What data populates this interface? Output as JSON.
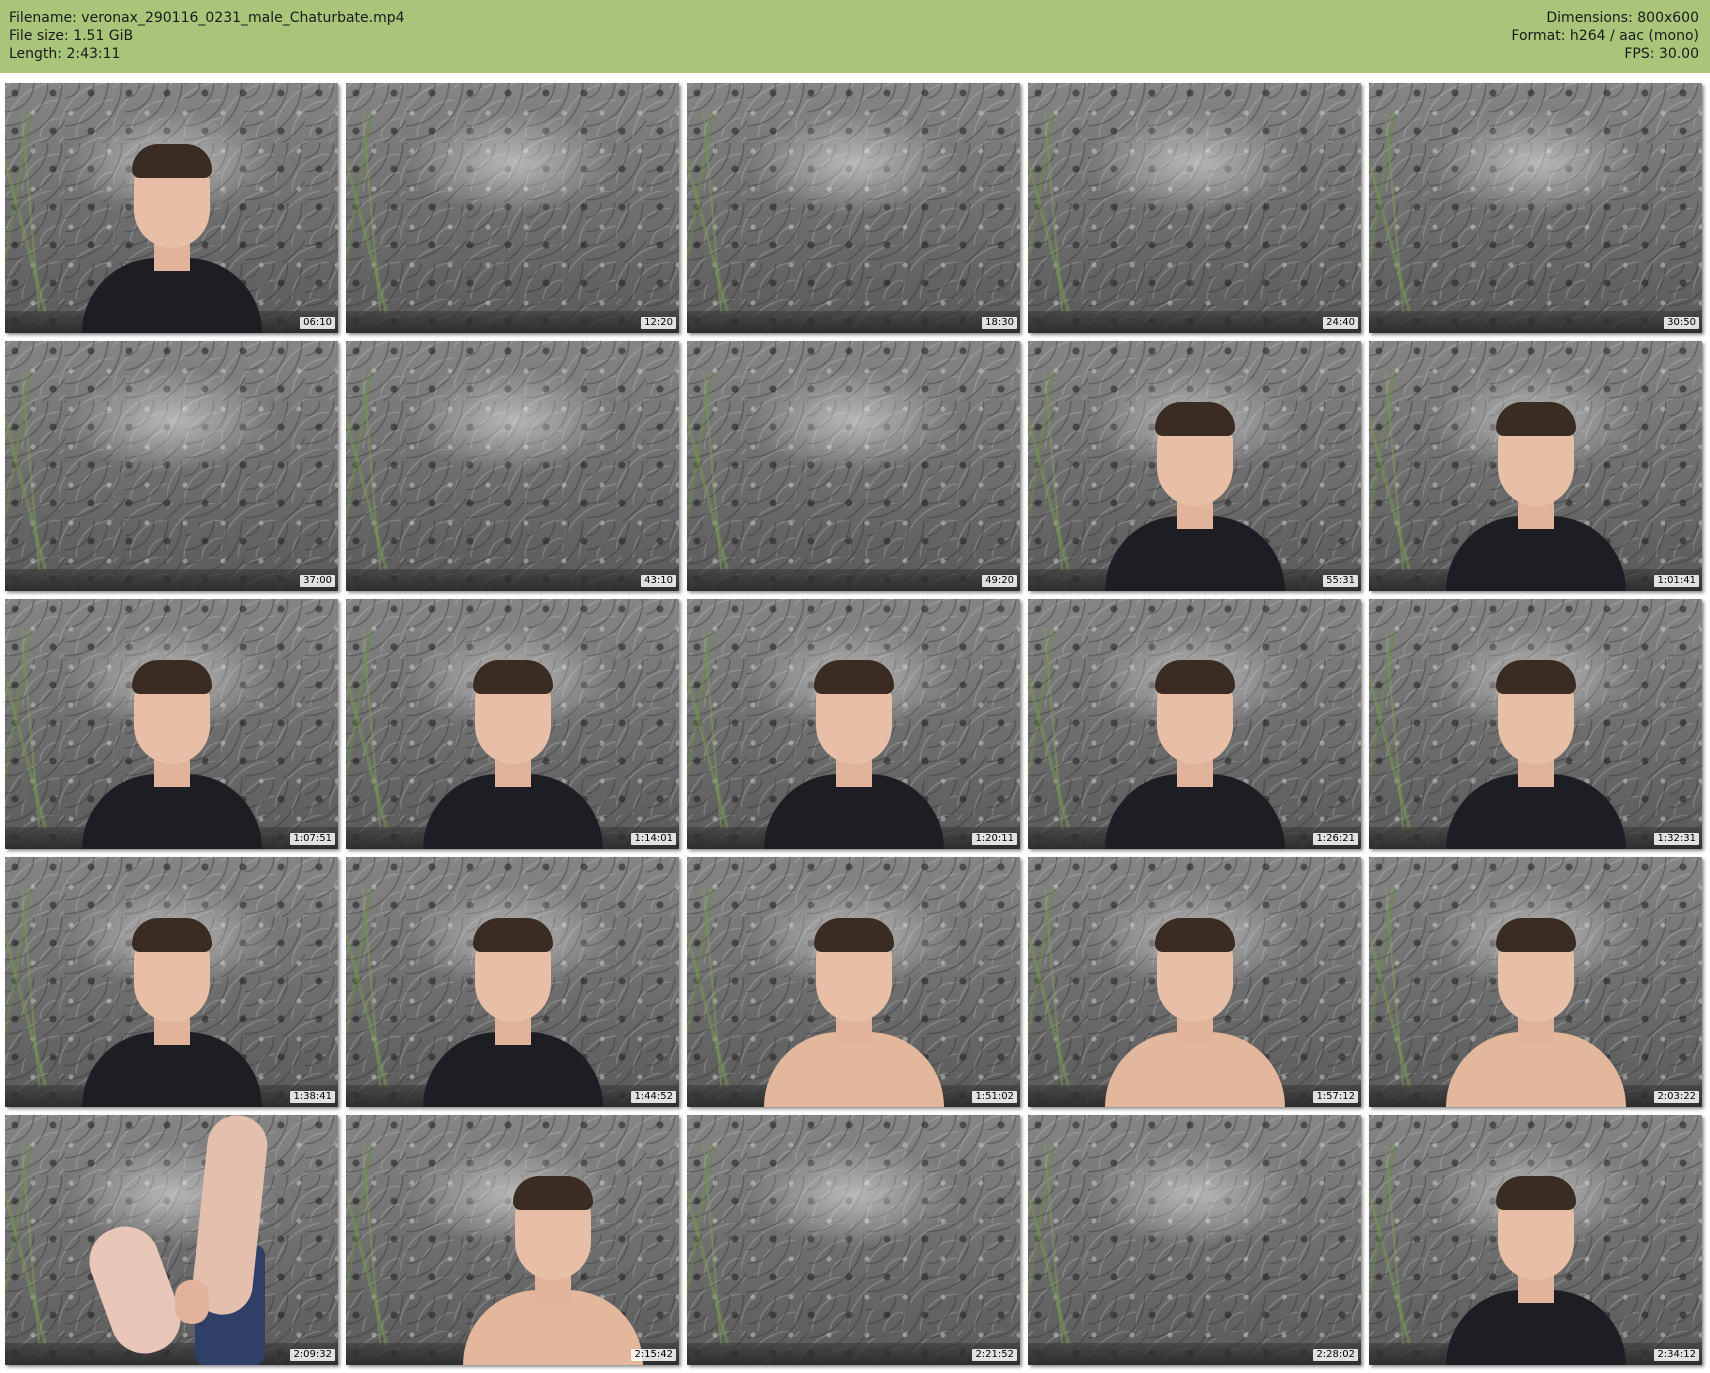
{
  "header": {
    "filename": "Filename: veronax_290116_0231_male_Chaturbate.mp4",
    "filesize": "File size: 1.51 GiB",
    "length": "Length: 2:43:11",
    "dimensions": "Dimensions: 800x600",
    "format": "Format: h264 / aac (mono)",
    "fps": "FPS: 30.00",
    "background_color": "#a8c57a"
  },
  "thumbnails": [
    {
      "time": "06:10",
      "scene": "person-tshirt"
    },
    {
      "time": "12:20",
      "scene": "empty"
    },
    {
      "time": "18:30",
      "scene": "empty"
    },
    {
      "time": "24:40",
      "scene": "empty"
    },
    {
      "time": "30:50",
      "scene": "empty"
    },
    {
      "time": "37:00",
      "scene": "empty"
    },
    {
      "time": "43:10",
      "scene": "empty"
    },
    {
      "time": "49:20",
      "scene": "empty"
    },
    {
      "time": "55:31",
      "scene": "person-tshirt"
    },
    {
      "time": "1:01:41",
      "scene": "person-tshirt"
    },
    {
      "time": "1:07:51",
      "scene": "person-tshirt"
    },
    {
      "time": "1:14:01",
      "scene": "person-tshirt"
    },
    {
      "time": "1:20:11",
      "scene": "person-tshirt"
    },
    {
      "time": "1:26:21",
      "scene": "person-tshirt"
    },
    {
      "time": "1:32:31",
      "scene": "person-tshirt"
    },
    {
      "time": "1:38:41",
      "scene": "person-tshirt"
    },
    {
      "time": "1:44:52",
      "scene": "person-tshirt"
    },
    {
      "time": "1:51:02",
      "scene": "person-shirtless"
    },
    {
      "time": "1:57:12",
      "scene": "person-shirtless"
    },
    {
      "time": "2:03:22",
      "scene": "person-shirtless"
    },
    {
      "time": "2:09:32",
      "scene": "feet"
    },
    {
      "time": "2:15:42",
      "scene": "person-shirtless"
    },
    {
      "time": "2:21:52",
      "scene": "empty"
    },
    {
      "time": "2:28:02",
      "scene": "empty"
    },
    {
      "time": "2:34:12",
      "scene": "person-tshirt"
    }
  ]
}
